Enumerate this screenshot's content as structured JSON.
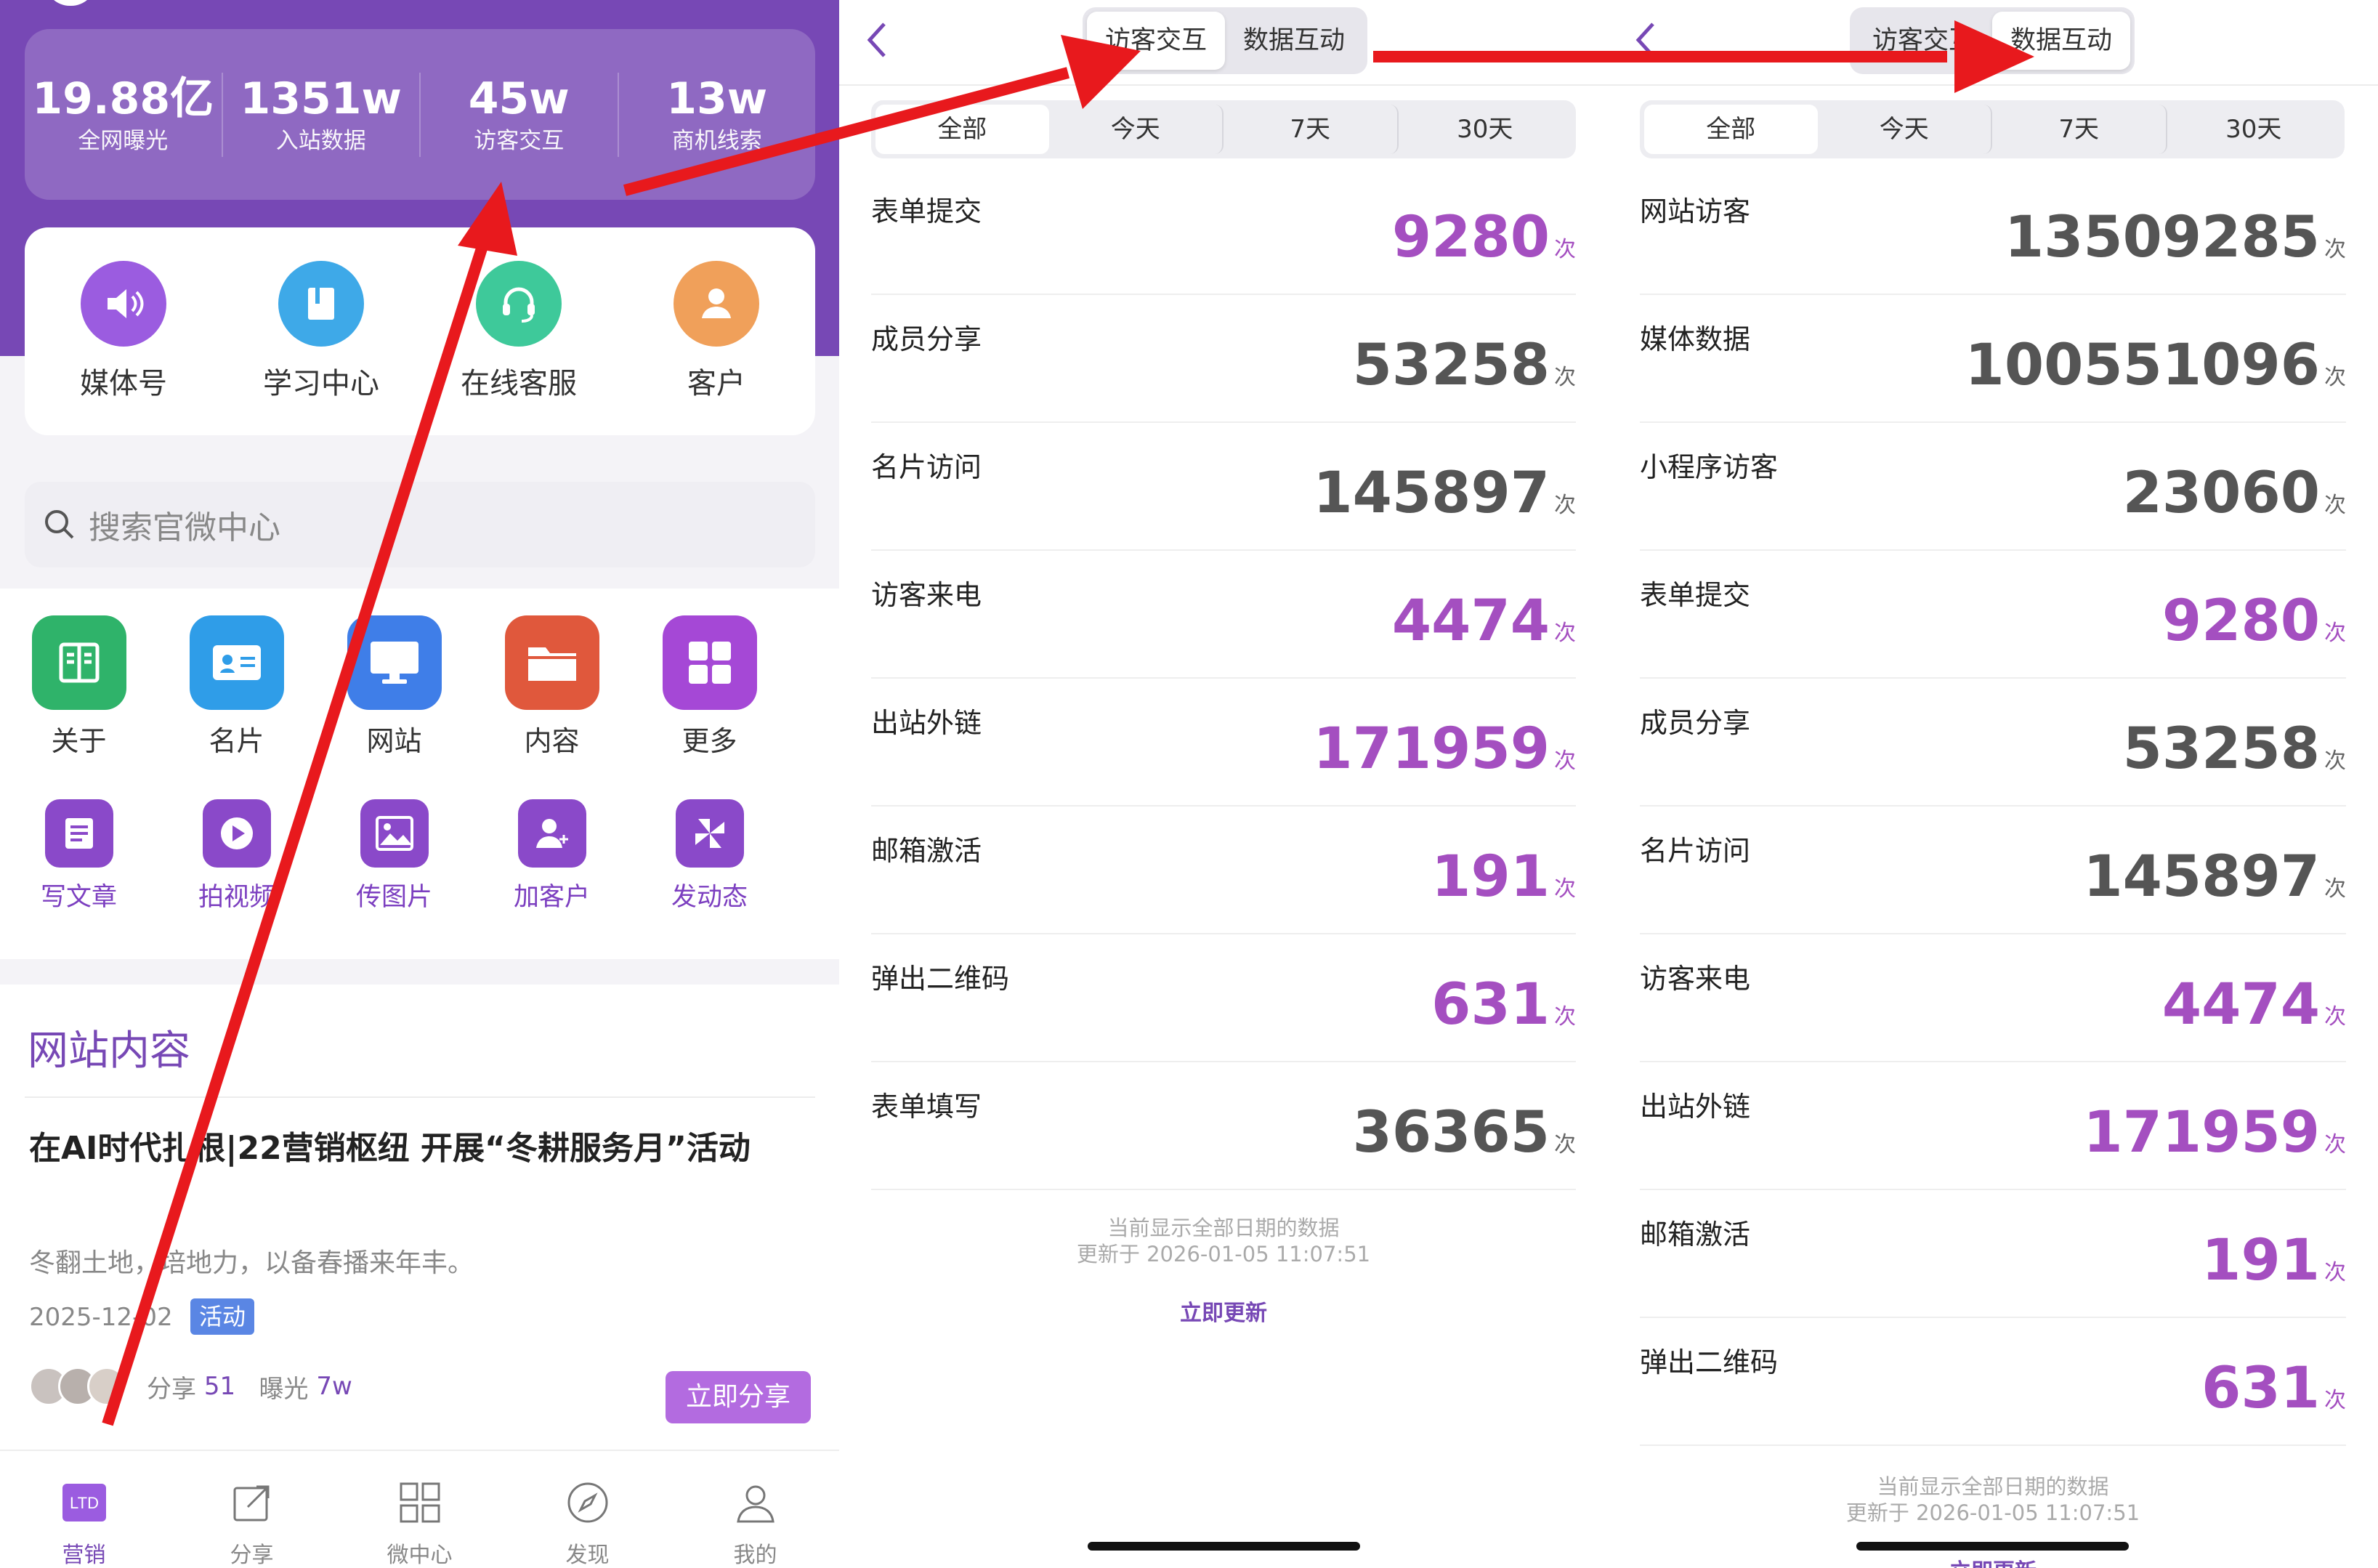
{
  "home": {
    "stats": [
      {
        "value": "19.88亿",
        "label": "全网曝光"
      },
      {
        "value": "1351w",
        "label": "入站数据"
      },
      {
        "value": "45w",
        "label": "访客交互"
      },
      {
        "value": "13w",
        "label": "商机线索"
      }
    ],
    "quick": [
      {
        "label": "媒体号",
        "icon": "speaker-icon",
        "color": "#9b5ce0"
      },
      {
        "label": "学习中心",
        "icon": "book-icon",
        "color": "#3ea9e8"
      },
      {
        "label": "在线客服",
        "icon": "headset-icon",
        "color": "#3ec99a"
      },
      {
        "label": "客户",
        "icon": "user-icon",
        "color": "#f0a05a"
      }
    ],
    "search_placeholder": "搜索官微中心",
    "apps": [
      {
        "label": "关于",
        "icon": "about-icon",
        "color": "#2fb36a"
      },
      {
        "label": "名片",
        "icon": "card-icon",
        "color": "#2f9de8"
      },
      {
        "label": "网站",
        "icon": "monitor-icon",
        "color": "#3f7ee8"
      },
      {
        "label": "内容",
        "icon": "folder-icon",
        "color": "#e0583c"
      },
      {
        "label": "更多",
        "icon": "grid-icon",
        "color": "#a548d6"
      }
    ],
    "tools": [
      {
        "label": "写文章",
        "icon": "article-icon"
      },
      {
        "label": "拍视频",
        "icon": "video-icon"
      },
      {
        "label": "传图片",
        "icon": "image-icon"
      },
      {
        "label": "加客户",
        "icon": "add-user-icon"
      },
      {
        "label": "发动态",
        "icon": "pinwheel-icon"
      }
    ],
    "content": {
      "title": "网站内容",
      "article_title": "在AI时代扎根|22营销枢纽 开展“冬耕服务月”活动",
      "article_sub": "冬翻土地，培地力，以备春播来年丰。",
      "date": "2025-12-02",
      "tag": "活动",
      "share_label": "分享",
      "share_count": "51",
      "exposure_label": "曝光",
      "exposure_count": "7w",
      "share_button": "立即分享"
    },
    "tabs": [
      {
        "label": "营销",
        "icon": "ltd-icon",
        "active": true
      },
      {
        "label": "分享",
        "icon": "share-icon",
        "active": false
      },
      {
        "label": "微中心",
        "icon": "apps-icon",
        "active": false
      },
      {
        "label": "发现",
        "icon": "compass-icon",
        "active": false
      },
      {
        "label": "我的",
        "icon": "profile-icon",
        "active": false
      }
    ],
    "ltd_text": "LTD"
  },
  "visitor": {
    "seg": [
      "访客交互",
      "数据互动"
    ],
    "seg_active": 0,
    "ranges": [
      "全部",
      "今天",
      "7天",
      "30天"
    ],
    "unit": "次",
    "rows": [
      {
        "label": "表单提交",
        "value": "9280",
        "purple": true
      },
      {
        "label": "成员分享",
        "value": "53258",
        "purple": false
      },
      {
        "label": "名片访问",
        "value": "145897",
        "purple": false
      },
      {
        "label": "访客来电",
        "value": "4474",
        "purple": true
      },
      {
        "label": "出站外链",
        "value": "171959",
        "purple": true
      },
      {
        "label": "邮箱激活",
        "value": "191",
        "purple": true
      },
      {
        "label": "弹出二维码",
        "value": "631",
        "purple": true
      },
      {
        "label": "表单填写",
        "value": "36365",
        "purple": false
      }
    ],
    "footer1": "当前显示全部日期的数据",
    "footer2": "更新于 2026-01-05 11:07:51",
    "update": "立即更新"
  },
  "data": {
    "seg": [
      "访客交互",
      "数据互动"
    ],
    "seg_active": 1,
    "ranges": [
      "全部",
      "今天",
      "7天",
      "30天"
    ],
    "unit": "次",
    "rows": [
      {
        "label": "网站访客",
        "value": "13509285",
        "purple": false
      },
      {
        "label": "媒体数据",
        "value": "100551096",
        "purple": false
      },
      {
        "label": "小程序访客",
        "value": "23060",
        "purple": false
      },
      {
        "label": "表单提交",
        "value": "9280",
        "purple": true
      },
      {
        "label": "成员分享",
        "value": "53258",
        "purple": false
      },
      {
        "label": "名片访问",
        "value": "145897",
        "purple": false
      },
      {
        "label": "访客来电",
        "value": "4474",
        "purple": true
      },
      {
        "label": "出站外链",
        "value": "171959",
        "purple": true
      },
      {
        "label": "邮箱激活",
        "value": "191",
        "purple": true
      },
      {
        "label": "弹出二维码",
        "value": "631",
        "purple": true
      }
    ],
    "footer1": "当前显示全部日期的数据",
    "footer2": "更新于 2026-01-05 11:07:51",
    "update": "立即更新"
  },
  "colors": {
    "brand": "#7748b5",
    "accent": "#a44fc0",
    "arrow": "#e8191d"
  }
}
